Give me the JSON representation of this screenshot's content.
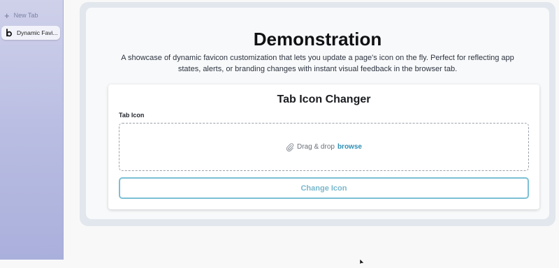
{
  "sidebar": {
    "new_tab_label": "New Tab",
    "active_tab_label": "Dynamic Favi..."
  },
  "main": {
    "title": "Demonstration",
    "description": "A showcase of dynamic favicon customization that lets you update a page's icon on the fly. Perfect for reflecting app states, alerts, or branding changes with instant visual feedback in the browser tab."
  },
  "panel": {
    "title": "Tab Icon Changer",
    "field_label": "Tab Icon",
    "drop_text": "Drag & drop",
    "browse_text": "browse",
    "button_label": "Change Icon"
  },
  "icons": {
    "new_tab": "plus-icon",
    "tab_favicon": "letter-b-favicon-icon",
    "attachment": "paperclip-icon",
    "cursor": "mouse-pointer-icon"
  },
  "colors": {
    "accent": "#2e8fb5",
    "button_border": "#7cc0d6",
    "sidebar": "#b9bde2"
  }
}
